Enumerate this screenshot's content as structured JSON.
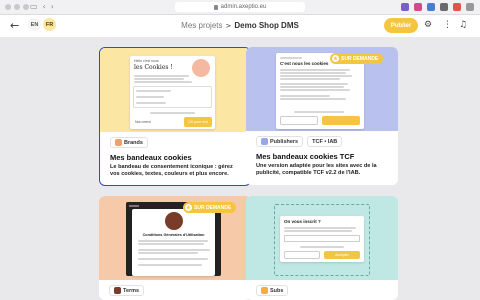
{
  "browser": {
    "url": "admin.axeptio.eu"
  },
  "colors": {
    "accent": "#f5c542",
    "selected_border": "#3b47c4"
  },
  "header": {
    "back_icon": "arrow-left-icon",
    "lang_en": "EN",
    "lang_fr": "FR",
    "crumb_projects": "Mes projets",
    "crumb_current": "Demo Shop DMS",
    "publish_label": "Publier"
  },
  "cards": [
    {
      "tags": [
        "Brands"
      ],
      "title": "Mes bandeaux cookies",
      "description": "Le bandeau de consentement iconique : gérez vos cookies, textes, couleurs et plus encore.",
      "preview": {
        "small": "Hello c'est nous",
        "heading": "les Cookies !",
        "accept": "OK pour moi",
        "deny": "Non merci"
      },
      "color": "#fbe7a3"
    },
    {
      "tags": [
        "Publishers",
        "TCF • IAB"
      ],
      "title": "Mes bandeaux cookies TCF",
      "description": "Une version adaptée pour les sites avec de la publicité, compatible TCF v2.2 de l'IAB.",
      "badge": "SUR DEMANDE",
      "preview": {
        "heading": "C'est nous les cookies"
      },
      "color": "#b9c2ef"
    },
    {
      "tags": [
        "Terms"
      ],
      "badge": "SUR DEMANDE",
      "preview": {
        "heading": "Conditions Générales d'Utilisation"
      },
      "color": "#f6c9a8"
    },
    {
      "tags": [
        "Subs"
      ],
      "preview": {
        "heading": "On vous inscrit ?",
        "button": "Accepter"
      },
      "color": "#bfe8e4"
    }
  ]
}
